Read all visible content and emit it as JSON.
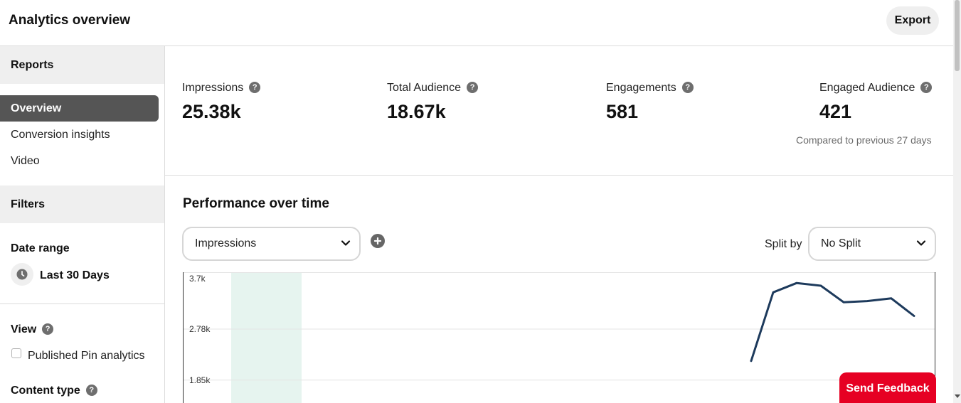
{
  "header": {
    "title": "Analytics overview",
    "export_label": "Export"
  },
  "sidebar": {
    "reports_heading": "Reports",
    "nav_items": [
      "Overview",
      "Conversion insights",
      "Video"
    ],
    "active_item": "Overview",
    "filters_heading": "Filters",
    "date_range_label": "Date range",
    "date_range_value": "Last 30 Days",
    "view_label": "View",
    "published_pin_label": "Published Pin analytics",
    "published_pin_checked": false,
    "content_type_label": "Content type"
  },
  "metrics": [
    {
      "label": "Impressions",
      "value": "25.38k"
    },
    {
      "label": "Total Audience",
      "value": "18.67k"
    },
    {
      "label": "Engagements",
      "value": "581"
    },
    {
      "label": "Engaged Audience",
      "value": "421"
    }
  ],
  "compare_note": "Compared to previous 27 days",
  "performance": {
    "title": "Performance over time",
    "metric_select": "Impressions",
    "split_label": "Split by",
    "split_select": "No Split"
  },
  "chart_data": {
    "type": "line",
    "series": [
      {
        "values": [
          2200,
          3450,
          3620,
          3570,
          3270,
          3290,
          3340,
          3020
        ]
      }
    ],
    "ytick_labels": [
      "3.7k",
      "2.78k",
      "1.85k"
    ],
    "yticks": [
      3700,
      2780,
      1850
    ],
    "ylim_visible": [
      1550,
      3700
    ],
    "line_color": "#1d3a5c",
    "highlight_color": "#e6f4ef",
    "grid": true
  },
  "feedback_label": "Send Feedback",
  "colors": {
    "accent": "#e60023",
    "active_nav": "#555555",
    "section_bg": "#efefef"
  }
}
